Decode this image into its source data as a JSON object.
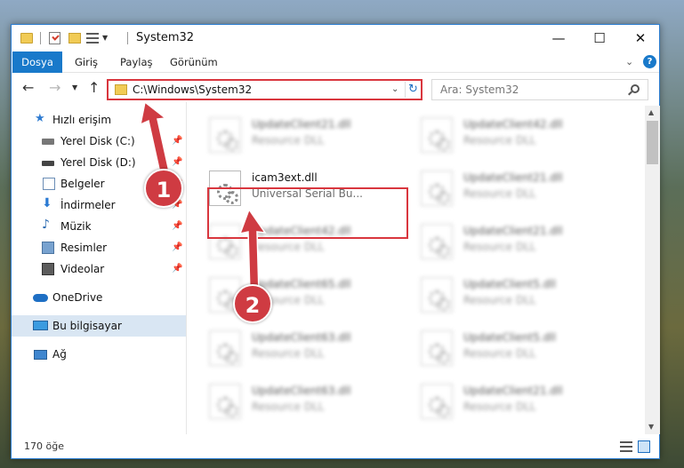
{
  "window": {
    "title": "System32",
    "minimize": "—",
    "maximize": "☐",
    "close": "✕"
  },
  "ribbon": {
    "tabs": [
      "Dosya",
      "Giriş",
      "Paylaş",
      "Görünüm"
    ],
    "help": "?"
  },
  "nav": {
    "address": "C:\\Windows\\System32",
    "search_placeholder": "Ara: System32"
  },
  "sidebar": {
    "items": [
      {
        "label": "Hızlı erişim",
        "pinned": false
      },
      {
        "label": "Yerel Disk (C:)",
        "pinned": true
      },
      {
        "label": "Yerel Disk (D:)",
        "pinned": true
      },
      {
        "label": "Belgeler",
        "pinned": true
      },
      {
        "label": "İndirmeler",
        "pinned": true
      },
      {
        "label": "Müzik",
        "pinned": true
      },
      {
        "label": "Resimler",
        "pinned": true
      },
      {
        "label": "Videolar",
        "pinned": true
      },
      {
        "label": "OneDrive",
        "pinned": false
      },
      {
        "label": "Bu bilgisayar",
        "pinned": false,
        "selected": true
      },
      {
        "label": "Ağ",
        "pinned": false
      }
    ]
  },
  "files": {
    "left": [
      {
        "name": "UpdateClient21.dll",
        "desc": "Resource DLL"
      },
      {
        "name": "icam3ext.dll",
        "desc": "Universal Serial Bu..."
      },
      {
        "name": "UpdateClient42.dll",
        "desc": "Resource DLL"
      },
      {
        "name": "UpdateClient65.dll",
        "desc": "Resource DLL"
      },
      {
        "name": "UpdateClient63.dll",
        "desc": "Resource DLL"
      },
      {
        "name": "UpdateClient63.dll",
        "desc": "Resource DLL"
      }
    ],
    "right": [
      {
        "name": "UpdateClient42.dll",
        "desc": "Resource DLL"
      },
      {
        "name": "UpdateClient21.dll",
        "desc": "Resource DLL"
      },
      {
        "name": "UpdateClient21.dll",
        "desc": "Resource DLL"
      },
      {
        "name": "UpdateClient5.dll",
        "desc": "Resource DLL"
      },
      {
        "name": "UpdateClient5.dll",
        "desc": "Resource DLL"
      },
      {
        "name": "UpdateClient21.dll",
        "desc": "Resource DLL"
      }
    ]
  },
  "status": {
    "count": "170 öğe"
  },
  "annotations": {
    "step1": "1",
    "step2": "2",
    "color": "#cf3b42"
  }
}
